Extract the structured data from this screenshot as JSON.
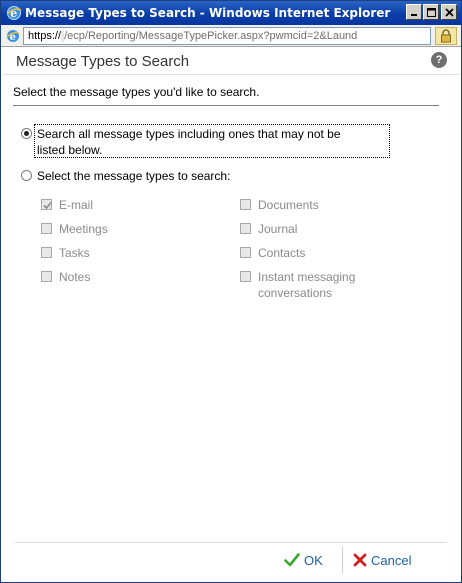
{
  "window": {
    "title": "Message Types to Search - Windows Internet Explorer"
  },
  "address": {
    "scheme": "https://",
    "host": "            ",
    "path": "/ecp/Reporting/MessageTypePicker.aspx?pwmcid=2&Laund"
  },
  "page": {
    "title": "Message Types to Search",
    "help": "?",
    "instruction": "Select the message types you'd like to search."
  },
  "options": {
    "all_line1": "Search all message types including ones that may not be",
    "all_line2": "listed below.",
    "select": "Select the message types to search:"
  },
  "types": {
    "email": "E-mail",
    "meetings": "Meetings",
    "tasks": "Tasks",
    "notes": "Notes",
    "documents": "Documents",
    "journal": "Journal",
    "contacts": "Contacts",
    "im_line1": "Instant messaging",
    "im_line2": "conversations"
  },
  "footer": {
    "ok": "OK",
    "cancel": "Cancel"
  },
  "colors": {
    "link": "#1f5fa8",
    "ok_check": "#3aa830",
    "cancel_x": "#d02020"
  }
}
